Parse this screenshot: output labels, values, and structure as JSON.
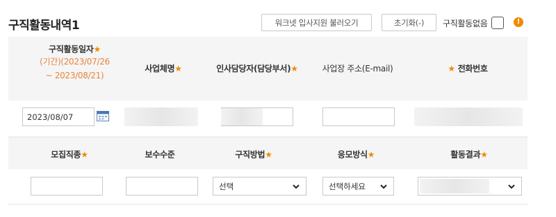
{
  "section": {
    "title": "구직활동내역1",
    "load_button": "워크넷 입사지원 불러오기",
    "reset_button": "초기화(-)",
    "no_activity_label": "구직활동없음",
    "warning_glyph": "!"
  },
  "header_row1": {
    "date_label": "구직활동일자",
    "date_range_line1": "(기간)(2023/07/26",
    "date_range_line2": "~ 2023/08/21)",
    "company_label": "사업체명",
    "manager_label": "인사담당자(담당부서)",
    "address_label": "사업장 주소(E-mail)",
    "phone_label": "전화번호",
    "required_mark": "★"
  },
  "row1": {
    "date_value": "2023/08/07"
  },
  "header_row2": {
    "job_label": "모집직종",
    "salary_label": "보수수준",
    "method_label": "구직방법",
    "apply_label": "응모방식",
    "result_label": "활동결과"
  },
  "row2": {
    "method_value": "선택",
    "apply_value": "선택하세요"
  },
  "colors": {
    "accent": "#f08a00",
    "header_bg": "#f5f5f5"
  }
}
